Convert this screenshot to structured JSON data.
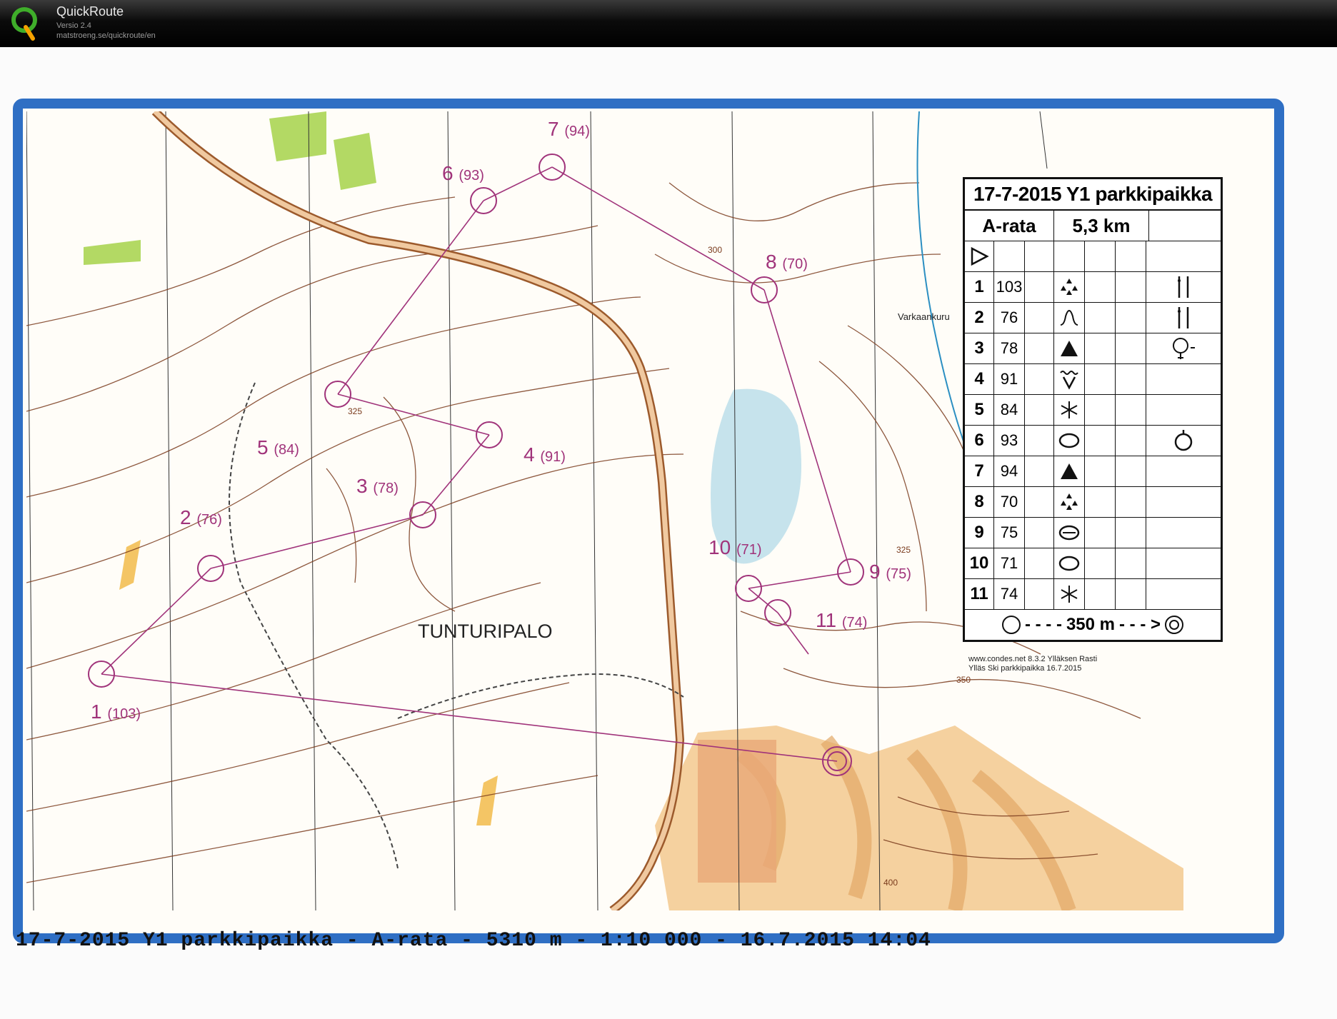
{
  "app": {
    "name": "QuickRoute",
    "version": "Versio 2.4",
    "url": "matstroeng.se/quickroute/en"
  },
  "map": {
    "place_name": "TUNTURIPALO",
    "stream_name": "Varkaankuru",
    "contour_labels": [
      "300",
      "325",
      "325",
      "350",
      "400"
    ],
    "colors": {
      "frame": "#2f6fc4",
      "course": "#a0337a",
      "contour": "#7a3b1d",
      "water": "#2c8fc2",
      "open": "#f3c98f",
      "green": "#9acc33"
    },
    "controls": [
      {
        "num": "1",
        "code": "(103)"
      },
      {
        "num": "2",
        "code": "(76)"
      },
      {
        "num": "3",
        "code": "(78)"
      },
      {
        "num": "4",
        "code": "(91)"
      },
      {
        "num": "5",
        "code": "(84)"
      },
      {
        "num": "6",
        "code": "(93)"
      },
      {
        "num": "7",
        "code": "(94)"
      },
      {
        "num": "8",
        "code": "(70)"
      },
      {
        "num": "9",
        "code": "(75)"
      },
      {
        "num": "10",
        "code": "(71)"
      },
      {
        "num": "11",
        "code": "(74)"
      }
    ]
  },
  "description": {
    "title": "17-7-2015 Y1 parkkipaikka",
    "course": "A-rata",
    "length": "5,3 km",
    "rows": [
      {
        "num": "1",
        "code": "103",
        "symbol": "dot-triangles",
        "extra": "bar"
      },
      {
        "num": "2",
        "code": "76",
        "symbol": "knoll",
        "extra": "bar"
      },
      {
        "num": "3",
        "code": "78",
        "symbol": "boulder",
        "extra": "cairn"
      },
      {
        "num": "4",
        "code": "91",
        "symbol": "depression",
        "extra": ""
      },
      {
        "num": "5",
        "code": "84",
        "symbol": "special",
        "extra": ""
      },
      {
        "num": "6",
        "code": "93",
        "symbol": "pit",
        "extra": "dot-top"
      },
      {
        "num": "7",
        "code": "94",
        "symbol": "boulder",
        "extra": ""
      },
      {
        "num": "8",
        "code": "70",
        "symbol": "dot-triangles",
        "extra": ""
      },
      {
        "num": "9",
        "code": "75",
        "symbol": "theta",
        "extra": ""
      },
      {
        "num": "10",
        "code": "71",
        "symbol": "pit",
        "extra": ""
      },
      {
        "num": "11",
        "code": "74",
        "symbol": "special",
        "extra": ""
      }
    ],
    "finish": "350 m",
    "credits_line1": "www.condes.net 8.3.2 Ylläksen Rasti",
    "credits_line2": "Ylläs Ski parkkipaikka 16.7.2015"
  },
  "caption": "17-7-2015 Y1 parkkipaikka - A-rata - 5310 m - 1:10 000 - 16.7.2015 14:04"
}
